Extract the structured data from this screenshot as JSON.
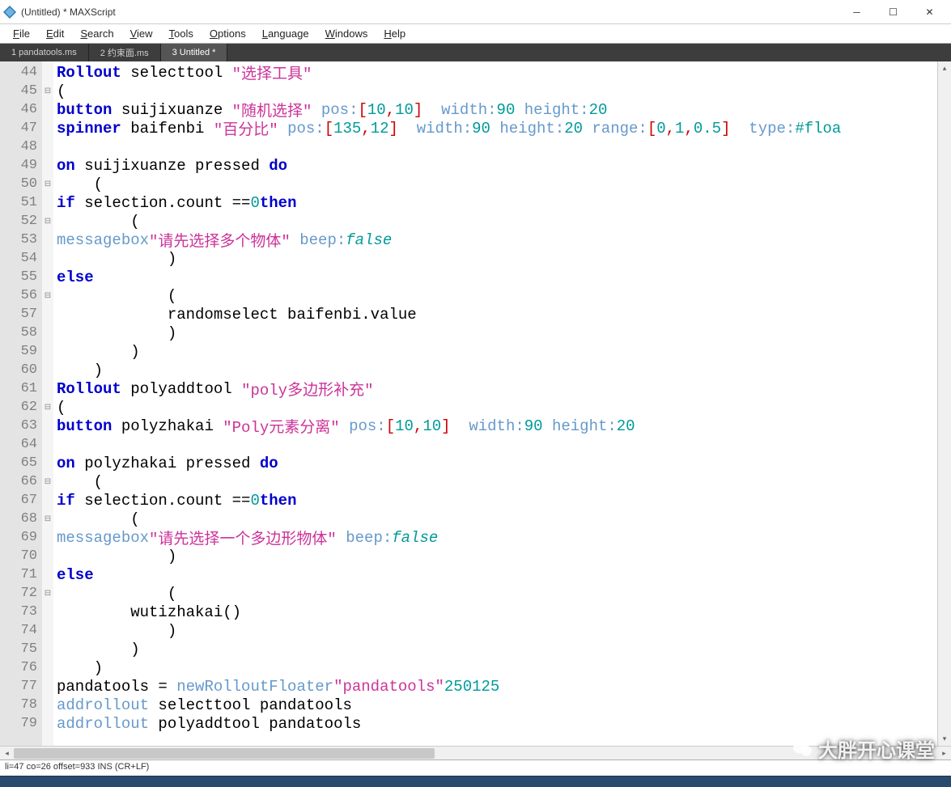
{
  "window": {
    "title": "(Untitled) * MAXScript"
  },
  "menus": {
    "file": "File",
    "edit": "Edit",
    "search": "Search",
    "view": "View",
    "tools": "Tools",
    "options": "Options",
    "language": "Language",
    "windows": "Windows",
    "help": "Help"
  },
  "tabs": {
    "t1": "1 pandatools.ms",
    "t2": "2 约束面.ms",
    "t3": "3 Untitled *"
  },
  "status": {
    "text": "li=47 co=26 offset=933 INS (CR+LF)"
  },
  "watermark": "大胖开心课堂",
  "lines": {
    "start": 44,
    "end": 79
  },
  "code": {
    "l44": {
      "kw": "Rollout",
      "id": " selecttool ",
      "str": "\"选择工具\""
    },
    "l45": {
      "t": "("
    },
    "l46": {
      "kw": "button",
      "id": " suijixuanze ",
      "str": "\"随机选择\"",
      "p1": " pos:",
      "br": "[",
      "n1": "10",
      "c": ",",
      "n2": "10",
      "br2": "]",
      "p2": "  width:",
      "n3": "90",
      "p3": " height:",
      "n4": "20"
    },
    "l47": {
      "kw": "spinner",
      "id": " baifenbi ",
      "str": "\"百分比\"",
      "p1": " pos:",
      "br": "[",
      "n1": "135",
      "c": ",",
      "n2": "12",
      "br2": "]",
      "p2": "  width:",
      "n3": "90",
      "p3": " height:",
      "n4": "20",
      "p4": " range:",
      "br3": "[",
      "n5": "0",
      "c2": ",",
      "n6": "1",
      "c3": ",",
      "n7": "0.5",
      "br4": "]",
      "p5": "  type:",
      "n8": "#floa"
    },
    "l48": {
      "t": ""
    },
    "l49": {
      "kw1": "on",
      "id": " suijixuanze pressed ",
      "kw2": "do"
    },
    "l50": {
      "t": "("
    },
    "l51": {
      "kw1": "if",
      "id": " selection.count ==",
      "n": "0",
      "sp": " ",
      "kw2": "then"
    },
    "l52": {
      "t": "("
    },
    "l53": {
      "fn": "messagebox",
      "sp": " ",
      "str": "\"请先选择多个物体\"",
      "p": " beep:",
      "it": "false"
    },
    "l54": {
      "t": ")"
    },
    "l55": {
      "kw": "else"
    },
    "l56": {
      "t": "("
    },
    "l57": {
      "t": "randomselect baifenbi.value"
    },
    "l58": {
      "t": ")"
    },
    "l59": {
      "t": ")"
    },
    "l60": {
      "t": ")"
    },
    "l61": {
      "kw": "Rollout",
      "id": " polyaddtool ",
      "str": "\"poly多边形补充\""
    },
    "l62": {
      "t": "("
    },
    "l63": {
      "kw": "button",
      "id": " polyzhakai ",
      "str": "\"Poly元素分离\"",
      "p1": " pos:",
      "br": "[",
      "n1": "10",
      "c": ",",
      "n2": "10",
      "br2": "]",
      "p2": "  width:",
      "n3": "90",
      "p3": " height:",
      "n4": "20"
    },
    "l64": {
      "t": ""
    },
    "l65": {
      "kw1": "on",
      "id": " polyzhakai pressed ",
      "kw2": "do"
    },
    "l66": {
      "t": "("
    },
    "l67": {
      "kw1": "if",
      "id": " selection.count ==",
      "n": "0",
      "sp": " ",
      "kw2": "then"
    },
    "l68": {
      "t": "("
    },
    "l69": {
      "fn": "messagebox",
      "sp": " ",
      "str": "\"请先选择一个多边形物体\"",
      "p": " beep:",
      "it": "false"
    },
    "l70": {
      "t": ")"
    },
    "l71": {
      "kw": "else"
    },
    "l72": {
      "t": "("
    },
    "l73": {
      "t": "wutizhakai()"
    },
    "l74": {
      "t": ")"
    },
    "l75": {
      "t": ")"
    },
    "l76": {
      "t": ")"
    },
    "l77": {
      "id1": "pandatools = ",
      "fn": "newRolloutFloater",
      "sp": " ",
      "str": "\"pandatools\"",
      "sp2": " ",
      "n1": "250",
      "sp3": " ",
      "n2": "125"
    },
    "l78": {
      "fn": "addrollout",
      "t": " selecttool pandatools"
    },
    "l79": {
      "fn": "addrollout",
      "t": " polyaddtool pandatools"
    }
  }
}
